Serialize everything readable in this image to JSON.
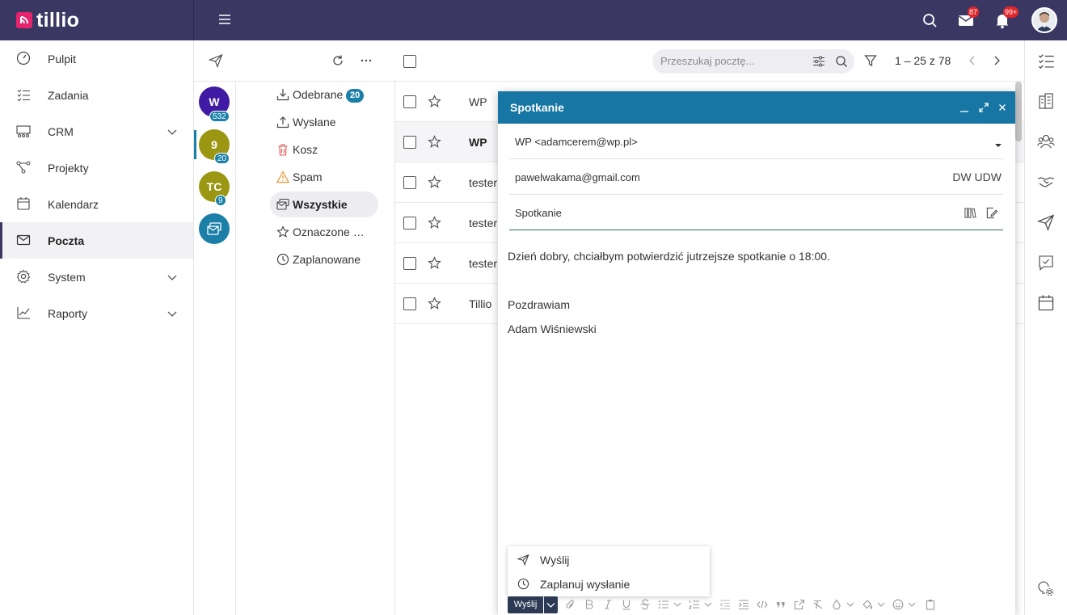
{
  "app": {
    "logo_text": "tillio",
    "brand_color": "#e6246e",
    "header_color": "#3a3863",
    "accent": "#1b7fa7"
  },
  "header": {
    "mail_badge": "87",
    "notifications_badge": "99+"
  },
  "sidebar": {
    "items": [
      {
        "label": "Pulpit",
        "icon": "dashboard-icon"
      },
      {
        "label": "Zadania",
        "icon": "tasks-icon"
      },
      {
        "label": "CRM",
        "icon": "crm-icon",
        "expandable": true
      },
      {
        "label": "Projekty",
        "icon": "projects-icon"
      },
      {
        "label": "Kalendarz",
        "icon": "calendar-icon"
      },
      {
        "label": "Poczta",
        "icon": "mail-icon",
        "active": true
      },
      {
        "label": "System",
        "icon": "gear-icon",
        "expandable": true
      },
      {
        "label": "Raporty",
        "icon": "chart-icon",
        "expandable": true
      }
    ]
  },
  "accounts": [
    {
      "initials": "W",
      "badge": "532",
      "color": "#3f1aa3"
    },
    {
      "initials": "9",
      "badge": "20",
      "color": "#9c9712"
    },
    {
      "initials": "TC",
      "badge": "9",
      "color": "#9c9712"
    },
    {
      "initials": "",
      "icon": "shared-mail-icon",
      "color": "#1b7fa7"
    }
  ],
  "folders": [
    {
      "label": "Odebrane",
      "count": "20",
      "icon": "inbox-icon"
    },
    {
      "label": "Wysłane",
      "icon": "sent-icon"
    },
    {
      "label": "Kosz",
      "icon": "trash-icon"
    },
    {
      "label": "Spam",
      "icon": "spam-icon"
    },
    {
      "label": "Wszystkie",
      "icon": "all-mail-icon",
      "active": true
    },
    {
      "label": "Oznaczone …",
      "icon": "star-icon"
    },
    {
      "label": "Zaplanowane",
      "icon": "clock-icon"
    }
  ],
  "list": {
    "search_placeholder": "Przeszukaj pocztę...",
    "pager": "1 – 25 z 78",
    "rows": [
      {
        "sender": "WP",
        "unread": false
      },
      {
        "sender": "WP",
        "unread": true
      },
      {
        "sender": "tester",
        "unread": false
      },
      {
        "sender": "tester",
        "unread": false
      },
      {
        "sender": "tester",
        "unread": false
      },
      {
        "sender": "Tillio",
        "unread": false
      }
    ]
  },
  "compose": {
    "title": "Spotkanie",
    "from": "WP <adamcerem@wp.pl>",
    "to": "pawelwakama@gmail.com",
    "cc_label": "DW UDW",
    "subject": "Spotkanie",
    "body": [
      "Dzień dobry, chciałbym potwierdzić jutrzejsze spotkanie o 18:00.",
      "Pozdrawiam",
      "Adam Wiśniewski"
    ],
    "send_menu": [
      {
        "label": "Wyślij",
        "icon": "send-icon"
      },
      {
        "label": "Zaplanuj wysłanie",
        "icon": "clock-icon"
      }
    ],
    "send_button": "Wyślij"
  }
}
